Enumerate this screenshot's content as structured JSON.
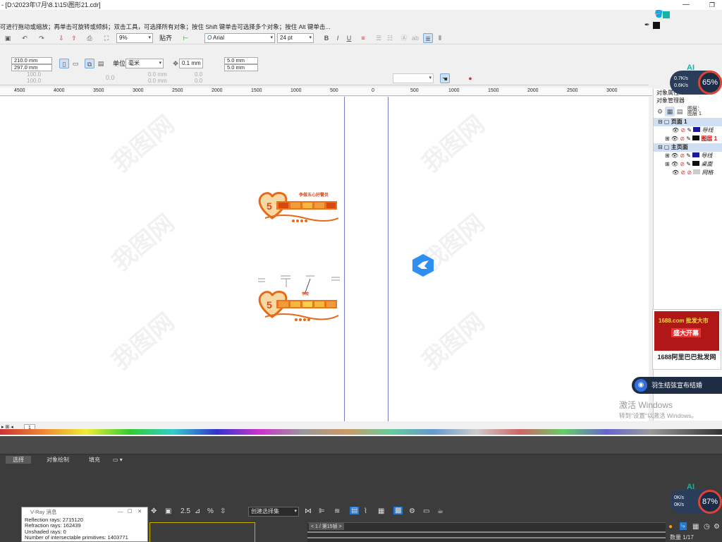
{
  "window": {
    "title": "- [D:\\2023年\\7月\\8.1\\15\\图形21.cdr]"
  },
  "status_hint": "可进行拖动或缩放；再单击可旋转或倾斜；双击工具，可选择所有对象；按住 Shift 键单击可选择多个对象；按住 Alt 键单击...",
  "toolbar": {
    "zoom": "9%",
    "snap_label": "贴齐",
    "font_name": "Arial",
    "font_size": "24 pt",
    "font_icon": "O"
  },
  "property_bar": {
    "width": "210.0 mm",
    "height": "297.0 mm",
    "unit_label": "单位:",
    "unit_value": "毫米",
    "nudge": "0.1 mm",
    "dup_x": "5.0 mm",
    "dup_y": "5.0 mm",
    "angle": "0.0",
    "scale_x": "100.0",
    "scale_y": "100.0",
    "pos_x": "0.0 mm",
    "pos_y": "0.0 mm",
    "off_x": "0.0",
    "off_y": "0.0"
  },
  "ruler": {
    "ticks": [
      "4500",
      "4000",
      "3500",
      "3000",
      "2500",
      "2000",
      "1500",
      "1000",
      "500",
      "0",
      "500",
      "1000",
      "1500",
      "2000",
      "2500",
      "3000"
    ]
  },
  "watermark": "我图网",
  "object_manager": {
    "tabs": [
      "对象属性",
      "对象管理器"
    ],
    "page_info": [
      "图层：",
      "图层 1"
    ],
    "rows": [
      {
        "label": "页面 1",
        "kind": "page"
      },
      {
        "label": "导线",
        "kind": "layer"
      },
      {
        "label": "图层 1",
        "kind": "layer-red"
      },
      {
        "label": "主页面",
        "kind": "page"
      },
      {
        "label": "导线",
        "kind": "layer"
      },
      {
        "label": "桌面",
        "kind": "layer"
      },
      {
        "label": "网格",
        "kind": "layer"
      }
    ]
  },
  "canvas_tabs": [
    "1"
  ],
  "designs": {
    "top_title": "争做五心好警员",
    "brand": "学校"
  },
  "bottom_tabs": [
    "选择",
    "对象绘制",
    "填充"
  ],
  "vray": {
    "title": "V-Ray 消息",
    "lines": [
      "Reflection rays: 2715120",
      "Refraction rays: 162439",
      "Unshaded rays: 0",
      "Number of intersectable primitives: 1403771"
    ]
  },
  "bottom_right": {
    "combo": "创建选择集",
    "track": "< 1 / 第15帧 >",
    "frame_label": "数量 1/17"
  },
  "gauge_top": {
    "label": "AI",
    "pct": "65%",
    "up": "0.7K/s",
    "down": "0.6K/s"
  },
  "gauge_bottom": {
    "label": "AI",
    "pct": "87%",
    "up": "0K/s",
    "down": "0K/s"
  },
  "ad": {
    "caption": "1688阿里巴巴批发网",
    "line1": "1688.com 批发大市",
    "line2": "盛大开幕"
  },
  "notice": "羽生结弦宣布结婚",
  "activate": {
    "title": "激活 Windows",
    "sub": "转到\"设置\"以激活 Windows。"
  },
  "colors": {
    "accent": "#7a7acc",
    "dark_bg": "#3c3c3c",
    "gauge_ring": "#d43",
    "teal": "#17b3a3",
    "orange": "#e8761e"
  }
}
